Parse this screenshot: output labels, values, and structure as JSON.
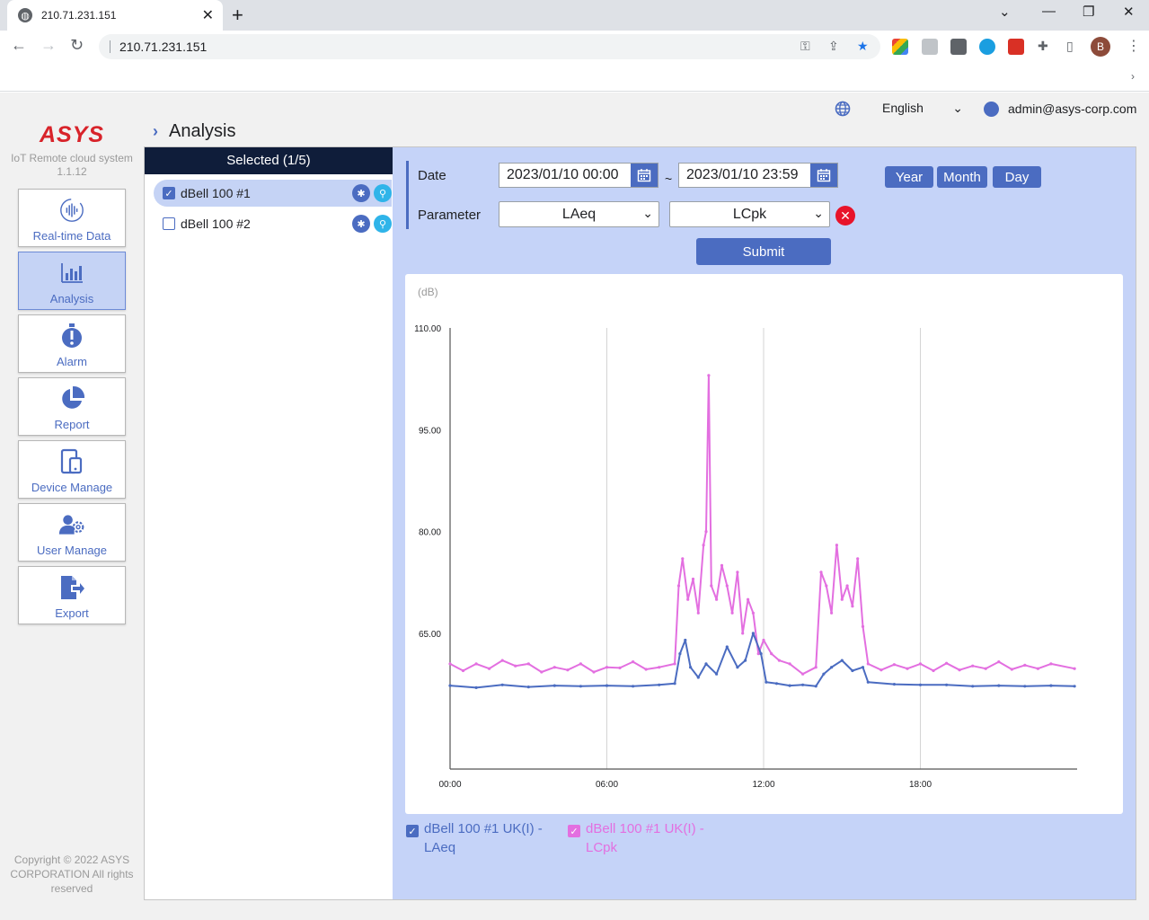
{
  "browser": {
    "tab_title": "210.71.231.151",
    "url": "210.71.231.151"
  },
  "topbar": {
    "language": "English",
    "user_email": "admin@asys-corp.com"
  },
  "brand": {
    "logo": "ASYS",
    "system_name": "IoT Remote cloud system",
    "version": "1.1.12",
    "color": "#d8232a"
  },
  "sidebar": {
    "items": [
      {
        "label": "Real-time Data",
        "icon": "realtime-icon",
        "active": false
      },
      {
        "label": "Analysis",
        "icon": "bar-chart-icon",
        "active": true
      },
      {
        "label": "Alarm",
        "icon": "alarm-icon",
        "active": false
      },
      {
        "label": "Report",
        "icon": "pie-chart-icon",
        "active": false
      },
      {
        "label": "Device Manage",
        "icon": "device-icon",
        "active": false
      },
      {
        "label": "User Manage",
        "icon": "user-gear-icon",
        "active": false
      },
      {
        "label": "Export",
        "icon": "export-icon",
        "active": false
      }
    ],
    "copyright": "Copyright © 2022 ASYS CORPORATION All rights reserved"
  },
  "page": {
    "title": "Analysis"
  },
  "devices": {
    "header": "Selected (1/5)",
    "items": [
      {
        "name": "dBell 100 #1",
        "checked": true
      },
      {
        "name": "dBell 100 #2",
        "checked": false
      }
    ]
  },
  "form": {
    "date_label": "Date",
    "start_date": "2023/01/10 00:00",
    "end_date": "2023/01/10 23:59",
    "separator": "~",
    "period_buttons": [
      "Year",
      "Month",
      "Day"
    ],
    "parameter_label": "Parameter",
    "parameter1": "LAeq",
    "parameter2": "LCpk",
    "submit_label": "Submit"
  },
  "colors": {
    "accent": "#4b6cc1",
    "panel_bg": "#c5d3f8",
    "series_laeq": "#4b6cc1",
    "series_lcpk": "#e36fe0"
  },
  "chart_data": {
    "type": "line",
    "ylabel": "(dB)",
    "y_ticks": [
      "110.00",
      "95.00",
      "80.00",
      "65.00"
    ],
    "x_ticks": [
      "00:00",
      "06:00",
      "12:00",
      "18:00"
    ],
    "ylim": [
      45,
      110
    ],
    "xlim_hours": [
      0,
      24
    ],
    "grid": "vertical",
    "series": [
      {
        "name": "dBell 100 #1 UK(I) - LAeq",
        "color": "#4b6cc1",
        "points": [
          [
            0,
            57.3
          ],
          [
            1,
            57.0
          ],
          [
            2,
            57.4
          ],
          [
            3,
            57.1
          ],
          [
            4,
            57.3
          ],
          [
            5,
            57.2
          ],
          [
            6,
            57.3
          ],
          [
            7,
            57.2
          ],
          [
            8,
            57.4
          ],
          [
            8.6,
            57.6
          ],
          [
            8.8,
            62
          ],
          [
            9,
            64
          ],
          [
            9.2,
            60
          ],
          [
            9.5,
            58.5
          ],
          [
            9.8,
            60.5
          ],
          [
            10.2,
            59
          ],
          [
            10.6,
            63
          ],
          [
            11,
            60
          ],
          [
            11.3,
            61
          ],
          [
            11.6,
            65
          ],
          [
            11.9,
            62
          ],
          [
            12.1,
            57.8
          ],
          [
            12.5,
            57.6
          ],
          [
            13,
            57.3
          ],
          [
            13.5,
            57.4
          ],
          [
            14,
            57.2
          ],
          [
            14.3,
            59
          ],
          [
            14.6,
            60
          ],
          [
            15,
            61
          ],
          [
            15.4,
            59.5
          ],
          [
            15.8,
            60
          ],
          [
            16,
            57.8
          ],
          [
            17,
            57.5
          ],
          [
            18,
            57.4
          ],
          [
            19,
            57.4
          ],
          [
            20,
            57.2
          ],
          [
            21,
            57.3
          ],
          [
            22,
            57.2
          ],
          [
            23,
            57.3
          ],
          [
            23.9,
            57.2
          ]
        ]
      },
      {
        "name": "dBell 100 #1 UK(I) - LCpk",
        "color": "#e36fe0",
        "points": [
          [
            0,
            60.5
          ],
          [
            0.5,
            59.5
          ],
          [
            1,
            60.5
          ],
          [
            1.5,
            59.8
          ],
          [
            2,
            61
          ],
          [
            2.5,
            60.2
          ],
          [
            3,
            60.5
          ],
          [
            3.5,
            59.3
          ],
          [
            4,
            60
          ],
          [
            4.5,
            59.6
          ],
          [
            5,
            60.5
          ],
          [
            5.5,
            59.3
          ],
          [
            6,
            60
          ],
          [
            6.5,
            59.9
          ],
          [
            7,
            60.8
          ],
          [
            7.5,
            59.7
          ],
          [
            8,
            60
          ],
          [
            8.6,
            60.5
          ],
          [
            8.75,
            72
          ],
          [
            8.9,
            76
          ],
          [
            9.1,
            70
          ],
          [
            9.3,
            73
          ],
          [
            9.5,
            68
          ],
          [
            9.7,
            78
          ],
          [
            9.8,
            80
          ],
          [
            9.9,
            103
          ],
          [
            10,
            72
          ],
          [
            10.2,
            70
          ],
          [
            10.4,
            75
          ],
          [
            10.6,
            72
          ],
          [
            10.8,
            68
          ],
          [
            11,
            74
          ],
          [
            11.2,
            65
          ],
          [
            11.4,
            70
          ],
          [
            11.6,
            68
          ],
          [
            11.8,
            62
          ],
          [
            12,
            64
          ],
          [
            12.3,
            62
          ],
          [
            12.6,
            61
          ],
          [
            13,
            60.5
          ],
          [
            13.5,
            59
          ],
          [
            14,
            60
          ],
          [
            14.2,
            74
          ],
          [
            14.4,
            72
          ],
          [
            14.6,
            68
          ],
          [
            14.8,
            78
          ],
          [
            15,
            70
          ],
          [
            15.2,
            72
          ],
          [
            15.4,
            69
          ],
          [
            15.6,
            76
          ],
          [
            15.8,
            66
          ],
          [
            16,
            60.5
          ],
          [
            16.5,
            59.6
          ],
          [
            17,
            60.4
          ],
          [
            17.5,
            59.8
          ],
          [
            18,
            60.5
          ],
          [
            18.5,
            59.5
          ],
          [
            19,
            60.6
          ],
          [
            19.5,
            59.6
          ],
          [
            20,
            60.2
          ],
          [
            20.5,
            59.8
          ],
          [
            21,
            60.8
          ],
          [
            21.5,
            59.7
          ],
          [
            22,
            60.3
          ],
          [
            22.5,
            59.8
          ],
          [
            23,
            60.5
          ],
          [
            23.9,
            59.8
          ]
        ]
      }
    ]
  }
}
